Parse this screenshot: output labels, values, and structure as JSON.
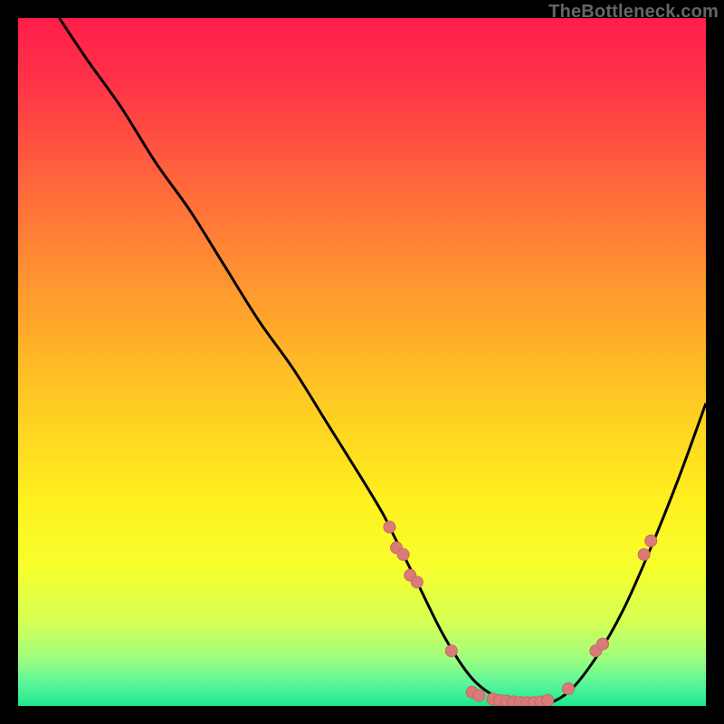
{
  "watermark": "TheBottleneck.com",
  "colors": {
    "gradient_stops": [
      {
        "offset": 0.0,
        "color": "#ff1d4a"
      },
      {
        "offset": 0.1,
        "color": "#ff3547"
      },
      {
        "offset": 0.25,
        "color": "#ff6a3b"
      },
      {
        "offset": 0.4,
        "color": "#ff9a2e"
      },
      {
        "offset": 0.55,
        "color": "#ffc823"
      },
      {
        "offset": 0.7,
        "color": "#fff01e"
      },
      {
        "offset": 0.8,
        "color": "#f6ff2d"
      },
      {
        "offset": 0.88,
        "color": "#d4ff55"
      },
      {
        "offset": 0.93,
        "color": "#a0ff7e"
      },
      {
        "offset": 0.97,
        "color": "#55f59b"
      },
      {
        "offset": 1.0,
        "color": "#20e68e"
      }
    ],
    "curve": "#000000",
    "dot_fill": "#d97b78",
    "dot_stroke": "#c96865"
  },
  "chart_data": {
    "type": "line",
    "title": "",
    "xlabel": "",
    "ylabel": "",
    "xlim": [
      0,
      100
    ],
    "ylim": [
      0,
      100
    ],
    "series": [
      {
        "name": "curve",
        "x": [
          6,
          10,
          15,
          20,
          25,
          30,
          35,
          40,
          45,
          50,
          53,
          55,
          58,
          62,
          66,
          70,
          73,
          76,
          80,
          84,
          88,
          92,
          96,
          100
        ],
        "y": [
          100,
          94,
          87,
          79,
          72,
          64,
          56,
          49,
          41,
          33,
          28,
          24,
          18,
          10,
          4,
          1,
          0,
          0,
          2,
          7,
          14,
          23,
          33,
          44
        ]
      }
    ],
    "scatter_points": [
      {
        "x": 54,
        "y": 26
      },
      {
        "x": 55,
        "y": 23
      },
      {
        "x": 56,
        "y": 22
      },
      {
        "x": 57,
        "y": 19
      },
      {
        "x": 58,
        "y": 18
      },
      {
        "x": 63,
        "y": 8
      },
      {
        "x": 66,
        "y": 2
      },
      {
        "x": 67,
        "y": 1.5
      },
      {
        "x": 69,
        "y": 1
      },
      {
        "x": 70,
        "y": 0.8
      },
      {
        "x": 71,
        "y": 0.7
      },
      {
        "x": 72,
        "y": 0.6
      },
      {
        "x": 73,
        "y": 0.5
      },
      {
        "x": 74,
        "y": 0.5
      },
      {
        "x": 75,
        "y": 0.5
      },
      {
        "x": 76,
        "y": 0.6
      },
      {
        "x": 77,
        "y": 0.8
      },
      {
        "x": 80,
        "y": 2.5
      },
      {
        "x": 84,
        "y": 8
      },
      {
        "x": 85,
        "y": 9
      },
      {
        "x": 91,
        "y": 22
      },
      {
        "x": 92,
        "y": 24
      }
    ]
  }
}
